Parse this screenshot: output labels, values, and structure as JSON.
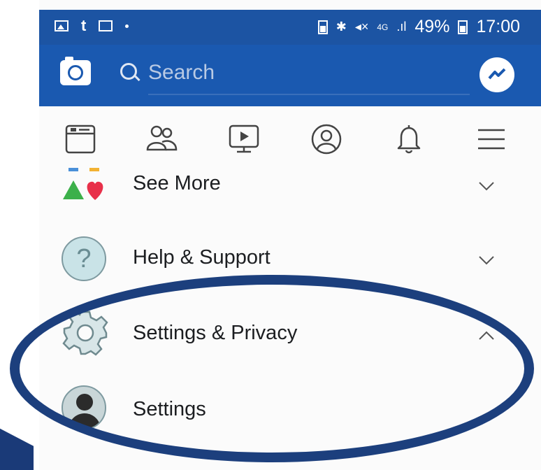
{
  "status_bar": {
    "left_icons": [
      "image-icon",
      "t",
      "mail-icon",
      "dot"
    ],
    "right_icons": [
      "battery-saver-icon",
      "bluetooth-icon",
      "mute-icon",
      "4g-icon",
      "signal-icon"
    ],
    "battery": "49%",
    "time": "17:00"
  },
  "app_bar": {
    "search_placeholder": "Search",
    "left_icon": "camera-icon",
    "right_icon": "messenger-icon",
    "color": "#1a59b0"
  },
  "tabs": [
    "news-feed-icon",
    "friends-icon",
    "watch-icon",
    "profile-icon",
    "notifications-icon",
    "menu-icon"
  ],
  "menu": {
    "see_more": "See More",
    "help_support": "Help & Support",
    "settings_privacy": "Settings & Privacy",
    "settings": "Settings"
  },
  "highlight_color": "#1c3f7d"
}
